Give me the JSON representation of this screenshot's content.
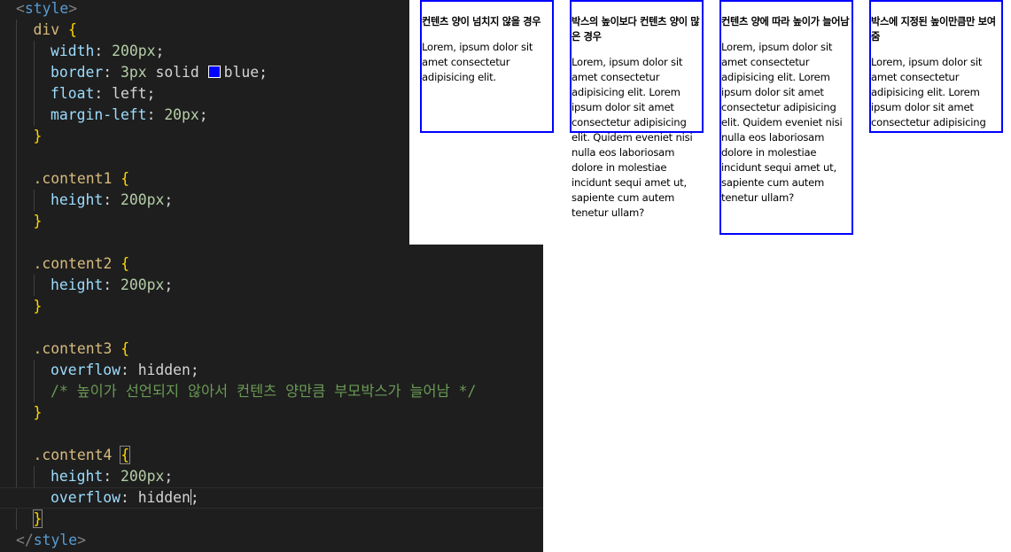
{
  "editor": {
    "lines": [
      [
        [
          "punct",
          "<"
        ],
        [
          "tag",
          "style"
        ],
        [
          "punct",
          ">"
        ]
      ],
      [
        [
          "sel",
          "div "
        ],
        [
          "brace",
          "{"
        ]
      ],
      [
        [
          "prop",
          "width"
        ],
        [
          "text",
          ": "
        ],
        [
          "num",
          "200px"
        ],
        [
          "text",
          ";"
        ]
      ],
      [
        [
          "prop",
          "border"
        ],
        [
          "text",
          ": "
        ],
        [
          "num",
          "3px"
        ],
        [
          "text",
          " solid "
        ],
        [
          "swatch",
          ""
        ],
        [
          "text",
          "blue;"
        ]
      ],
      [
        [
          "prop",
          "float"
        ],
        [
          "text",
          ": left;"
        ]
      ],
      [
        [
          "prop",
          "margin-left"
        ],
        [
          "text",
          ": "
        ],
        [
          "num",
          "20px"
        ],
        [
          "text",
          ";"
        ]
      ],
      [
        [
          "brace",
          "}"
        ]
      ],
      [],
      [
        [
          "sel",
          ".content1 "
        ],
        [
          "brace",
          "{"
        ]
      ],
      [
        [
          "prop",
          "height"
        ],
        [
          "text",
          ": "
        ],
        [
          "num",
          "200px"
        ],
        [
          "text",
          ";"
        ]
      ],
      [
        [
          "brace",
          "}"
        ]
      ],
      [],
      [
        [
          "sel",
          ".content2 "
        ],
        [
          "brace",
          "{"
        ]
      ],
      [
        [
          "prop",
          "height"
        ],
        [
          "text",
          ": "
        ],
        [
          "num",
          "200px"
        ],
        [
          "text",
          ";"
        ]
      ],
      [
        [
          "brace",
          "}"
        ]
      ],
      [],
      [
        [
          "sel",
          ".content3 "
        ],
        [
          "brace",
          "{"
        ]
      ],
      [
        [
          "prop",
          "overflow"
        ],
        [
          "text",
          ": hidden;"
        ]
      ],
      [
        [
          "comment",
          "/* 높이가 선언되지 않아서 컨텐츠 양만큼 부모박스가 늘어남 */"
        ]
      ],
      [
        [
          "brace",
          "}"
        ]
      ],
      [],
      [
        [
          "sel",
          ".content4 "
        ],
        [
          "brace",
          "{"
        ]
      ],
      [
        [
          "prop",
          "height"
        ],
        [
          "text",
          ": "
        ],
        [
          "num",
          "200px"
        ],
        [
          "text",
          ";"
        ]
      ],
      [
        [
          "prop",
          "overflow"
        ],
        [
          "text",
          ": hidden"
        ],
        [
          "cursor",
          ""
        ],
        [
          "text",
          ";"
        ]
      ],
      [
        [
          "brace",
          "}"
        ]
      ],
      [
        [
          "punct",
          "</"
        ],
        [
          "tag",
          "style"
        ],
        [
          "punct",
          ">"
        ]
      ]
    ],
    "indent": [
      0,
      1,
      2,
      2,
      2,
      2,
      1,
      0,
      1,
      2,
      1,
      0,
      1,
      2,
      1,
      0,
      1,
      2,
      2,
      1,
      0,
      1,
      2,
      2,
      1,
      0
    ],
    "swatch_color": "#0000ff",
    "current_line": 23
  },
  "preview": {
    "boxes": [
      {
        "title": "컨텐츠 양이 넘치지 않을 경우",
        "text": "Lorem, ipsum dolor sit amet consectetur adipisicing elit."
      },
      {
        "title": "박스의 높이보다 컨텐츠 양이 많은 경우",
        "text": "Lorem, ipsum dolor sit amet consectetur adipisicing elit. Lorem ipsum dolor sit amet consectetur adipisicing elit. Quidem eveniet nisi nulla eos laboriosam dolore in molestiae incidunt sequi amet ut, sapiente cum autem tenetur ullam?"
      },
      {
        "title": "컨텐츠 양에 따라 높이가 늘어남",
        "text": "Lorem, ipsum dolor sit amet consectetur adipisicing elit. Lorem ipsum dolor sit amet consectetur adipisicing elit. Quidem eveniet nisi nulla eos laboriosam dolore in molestiae incidunt sequi amet ut, sapiente cum autem tenetur ullam?"
      },
      {
        "title": "박스에 지정된 높이만큼만 보여줌",
        "text": "Lorem, ipsum dolor sit amet consectetur adipisicing elit. Lorem ipsum dolor sit amet consectetur adipisicing elit. Quidem eveniet nisi nulla eos laboriosam dolore in molestiae incidunt sequi amet ut, sapiente cum autem tenetur ullam?"
      }
    ],
    "border_color": "#0000ff"
  }
}
